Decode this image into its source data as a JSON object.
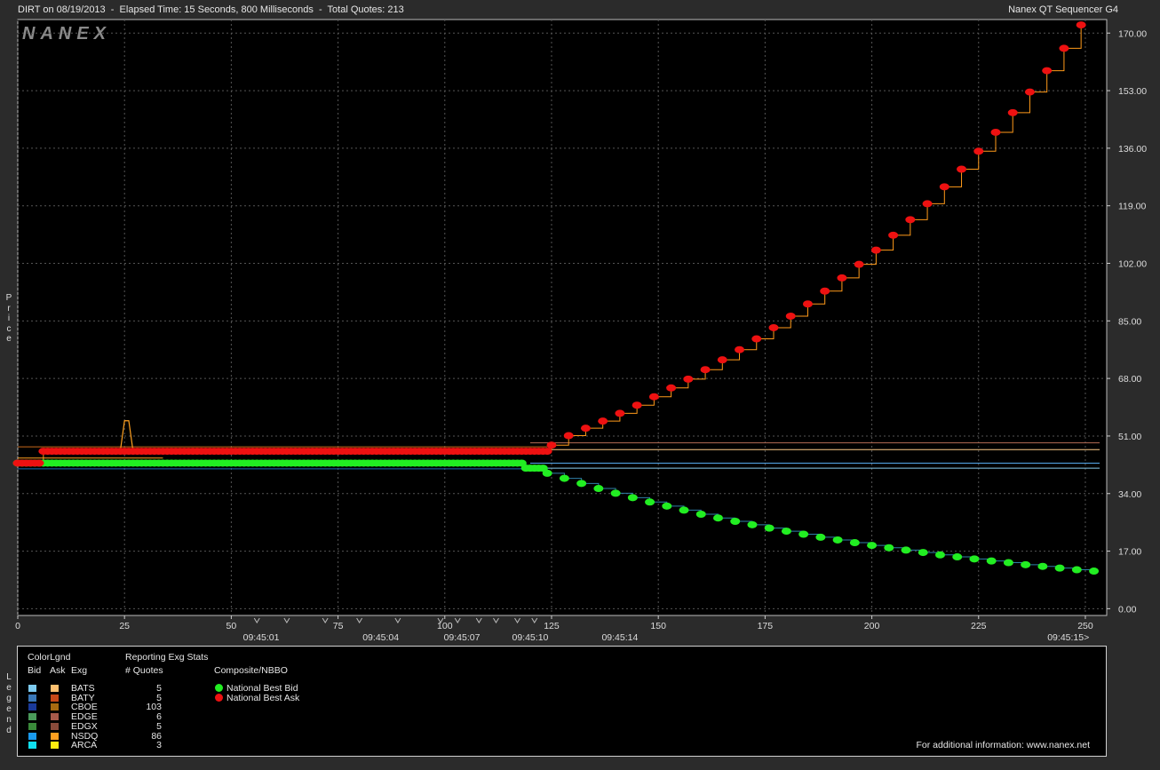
{
  "header": {
    "title_left": "DIRT on 08/19/2013  -  Elapsed Time: 15 Seconds, 800 Milliseconds  -  Total Quotes: 213",
    "title_right": "Nanex QT Sequencer G4"
  },
  "watermark": "NANEX",
  "price_label": "Price",
  "legend_label": "Legend",
  "colors": {
    "background": "#000000",
    "grid": "#555555",
    "bid_marker": "#22ee22",
    "ask_marker": "#ee1111",
    "bid_line": "#2f7fa8",
    "ask_line": "#ff9a1a"
  },
  "chart_data": {
    "type": "scatter",
    "x_axis": {
      "range": [
        0,
        255
      ],
      "ticks": [
        0,
        25,
        50,
        75,
        100,
        125,
        150,
        175,
        200,
        225,
        250
      ],
      "time_labels": [
        {
          "seq": 57,
          "label": "09:45:01"
        },
        {
          "seq": 85,
          "label": "09:45:04"
        },
        {
          "seq": 104,
          "label": "09:45:07"
        },
        {
          "seq": 120,
          "label": "09:45:10"
        },
        {
          "seq": 141,
          "label": "09:45:14"
        },
        {
          "seq": 246,
          "label": "09:45:15>"
        }
      ]
    },
    "y_axis": {
      "range": [
        -2,
        174
      ],
      "ticks": [
        "0.00",
        "17.00",
        "34.00",
        "51.00",
        "68.00",
        "85.00",
        "102.00",
        "119.00",
        "136.00",
        "153.00",
        "170.00"
      ],
      "label": "Price"
    },
    "series": [
      {
        "name": "National Best Ask",
        "color": "#ee1111",
        "points": [
          [
            0,
            43
          ],
          [
            1,
            43
          ],
          [
            2,
            43
          ],
          [
            3,
            43
          ],
          [
            4,
            43
          ],
          [
            5,
            43
          ],
          [
            6,
            46.5
          ],
          [
            124,
            46.5
          ],
          [
            125,
            48.3
          ],
          [
            129,
            51.1
          ],
          [
            133,
            53.3
          ],
          [
            137,
            55.4
          ],
          [
            141,
            57.7
          ],
          [
            145,
            60.1
          ],
          [
            149,
            62.6
          ],
          [
            153,
            65.2
          ],
          [
            157,
            67.8
          ],
          [
            161,
            70.6
          ],
          [
            165,
            73.5
          ],
          [
            169,
            76.5
          ],
          [
            173,
            79.7
          ],
          [
            177,
            83.0
          ],
          [
            181,
            86.4
          ],
          [
            185,
            90.0
          ],
          [
            189,
            93.8
          ],
          [
            193,
            97.7
          ],
          [
            197,
            101.7
          ],
          [
            201,
            105.9
          ],
          [
            205,
            110.3
          ],
          [
            209,
            114.9
          ],
          [
            213,
            119.6
          ],
          [
            217,
            124.6
          ],
          [
            221,
            129.8
          ],
          [
            225,
            135.1
          ],
          [
            229,
            140.7
          ],
          [
            233,
            146.5
          ],
          [
            237,
            152.6
          ],
          [
            241,
            158.9
          ],
          [
            245,
            165.5
          ],
          [
            249,
            172.4
          ]
        ]
      },
      {
        "name": "National Best Bid",
        "color": "#22ee22",
        "points": [
          [
            0,
            43
          ],
          [
            5,
            43
          ],
          [
            6,
            43
          ],
          [
            118,
            43
          ],
          [
            119,
            41.5
          ],
          [
            123,
            41.5
          ],
          [
            124,
            40
          ],
          [
            128,
            38.5
          ],
          [
            132,
            37.0
          ],
          [
            136,
            35.5
          ],
          [
            140,
            34.1
          ],
          [
            144,
            32.8
          ],
          [
            148,
            31.5
          ],
          [
            152,
            30.3
          ],
          [
            156,
            29.1
          ],
          [
            160,
            27.9
          ],
          [
            164,
            26.8
          ],
          [
            168,
            25.8
          ],
          [
            172,
            24.8
          ],
          [
            176,
            23.8
          ],
          [
            180,
            22.9
          ],
          [
            184,
            22.0
          ],
          [
            188,
            21.1
          ],
          [
            192,
            20.3
          ],
          [
            196,
            19.5
          ],
          [
            200,
            18.7
          ],
          [
            204,
            18.0
          ],
          [
            208,
            17.3
          ],
          [
            212,
            16.6
          ],
          [
            216,
            15.9
          ],
          [
            220,
            15.3
          ],
          [
            224,
            14.7
          ],
          [
            228,
            14.1
          ],
          [
            232,
            13.6
          ],
          [
            236,
            13.0
          ],
          [
            240,
            12.5
          ],
          [
            244,
            12.0
          ],
          [
            248,
            11.5
          ],
          [
            252,
            11.1
          ]
        ]
      }
    ],
    "exchange_lines": [
      {
        "exg": "EDGE",
        "side": "ask",
        "color": "#b56b54",
        "price": 49.0
      },
      {
        "exg": "BATS",
        "side": "ask",
        "color": "#ffcc88",
        "price": 47.0
      },
      {
        "exg": "NSDQ",
        "side": "bid",
        "color": "#55aaee",
        "price": 43.0
      },
      {
        "exg": "BATS",
        "side": "bid",
        "color": "#88ccee",
        "price": 41.5
      }
    ]
  },
  "legend": {
    "color_legend_title": "ColorLgnd",
    "col_bid": "Bid",
    "col_ask": "Ask",
    "col_exg": "Exg",
    "stats_title": "Reporting Exg Stats",
    "stats_col": "# Quotes",
    "composite_title": "Composite/NBBO",
    "exchanges": [
      {
        "name": "BATS",
        "bid_color": "#7ecbf0",
        "ask_color": "#ffc070",
        "quotes": "5"
      },
      {
        "name": "BATY",
        "bid_color": "#3a78b8",
        "ask_color": "#c84818",
        "quotes": "5"
      },
      {
        "name": "CBOE",
        "bid_color": "#1a3a9a",
        "ask_color": "#a86a10",
        "quotes": "103"
      },
      {
        "name": "EDGE",
        "bid_color": "#4a9a5a",
        "ask_color": "#a85a4a",
        "quotes": "6"
      },
      {
        "name": "EDGX",
        "bid_color": "#3a8a3a",
        "ask_color": "#8a4a3a",
        "quotes": "5"
      },
      {
        "name": "NSDQ",
        "bid_color": "#1a9aee",
        "ask_color": "#ffa020",
        "quotes": "86"
      },
      {
        "name": "ARCA",
        "bid_color": "#10e0f0",
        "ask_color": "#ffee10",
        "quotes": "3"
      }
    ],
    "nbbo": [
      {
        "name": "National Best Bid",
        "color": "#22ee22"
      },
      {
        "name": "National Best Ask",
        "color": "#ee1111"
      }
    ],
    "footer": "For additional information: www.nanex.net"
  }
}
